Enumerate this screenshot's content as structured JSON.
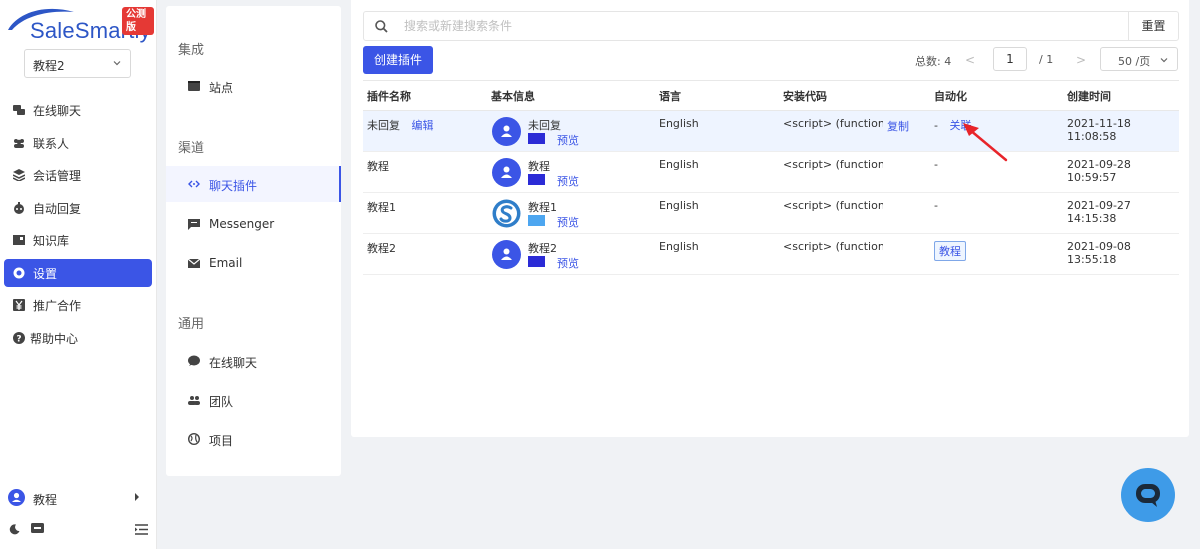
{
  "brand": {
    "name": "SaleSmartly",
    "badge": "公测版"
  },
  "project_selector": {
    "value": "教程2"
  },
  "nav": {
    "items": [
      {
        "id": "chat",
        "label": "在线聊天",
        "icon": "chat-bubbles-icon"
      },
      {
        "id": "contacts",
        "label": "联系人",
        "icon": "contacts-icon"
      },
      {
        "id": "sessions",
        "label": "会话管理",
        "icon": "layers-icon"
      },
      {
        "id": "auto",
        "label": "自动回复",
        "icon": "robot-icon"
      },
      {
        "id": "kb",
        "label": "知识库",
        "icon": "book-icon"
      },
      {
        "id": "settings",
        "label": "设置",
        "icon": "gear-icon",
        "active": true
      },
      {
        "id": "affiliate",
        "label": "推广合作",
        "icon": "yen-icon"
      },
      {
        "id": "help",
        "label": "帮助中心",
        "icon": "help-icon"
      }
    ]
  },
  "user": {
    "name": "教程"
  },
  "submenu": {
    "groups": [
      {
        "title": "集成",
        "items": [
          {
            "label": "站点",
            "icon": "site-icon"
          }
        ]
      },
      {
        "title": "渠道",
        "items": [
          {
            "label": "聊天插件",
            "icon": "code-icon",
            "active": true
          },
          {
            "label": "Messenger",
            "icon": "message-icon"
          },
          {
            "label": "Email",
            "icon": "mail-icon"
          }
        ]
      },
      {
        "title": "通用",
        "items": [
          {
            "label": "在线聊天",
            "icon": "chat-icon"
          },
          {
            "label": "团队",
            "icon": "team-icon"
          },
          {
            "label": "项目",
            "icon": "globe-icon"
          }
        ]
      }
    ]
  },
  "toolbar": {
    "search_placeholder": "搜索或新建搜索条件",
    "reset_label": "重置",
    "create_label": "创建插件"
  },
  "pagination": {
    "total_text": "总数: 4",
    "prev": "<",
    "next": ">",
    "page": "1",
    "pages_text": "/ 1",
    "page_size": "50 /页"
  },
  "table": {
    "headers": [
      "插件名称",
      "基本信息",
      "语言",
      "安装代码",
      "自动化",
      "创建时间"
    ],
    "rows": [
      {
        "name": "未回复",
        "edit": "编辑",
        "bot": "未回复",
        "swatch": "#2b2bd6",
        "preview": "预览",
        "lang": "English",
        "code": "<script> (function(...",
        "copy": "复制",
        "auto_dash": "-",
        "auto_link": "关联",
        "created": "2021-11-18 11:08:58",
        "highlight": true,
        "avatar": "person"
      },
      {
        "name": "教程",
        "bot": "教程",
        "swatch": "#2b2bd6",
        "preview": "预览",
        "lang": "English",
        "code": "<script> (function(...",
        "auto_dash": "-",
        "created": "2021-09-28 10:59:57",
        "avatar": "person"
      },
      {
        "name": "教程1",
        "bot": "教程1",
        "swatch": "#4da6f0",
        "preview": "预览",
        "lang": "English",
        "code": "<script> (function(...",
        "auto_dash": "-",
        "created": "2021-09-27 14:15:38",
        "avatar": "logo"
      },
      {
        "name": "教程2",
        "bot": "教程2",
        "swatch": "#2b2bd6",
        "preview": "预览",
        "lang": "English",
        "code": "<script> (function(...",
        "auto_tag": "教程",
        "created": "2021-09-08 13:55:18",
        "avatar": "person"
      }
    ]
  },
  "colors": {
    "primary": "#3b55e6",
    "fab": "#3e9be8",
    "badge": "#e53935",
    "annotation": "#e8242a"
  }
}
